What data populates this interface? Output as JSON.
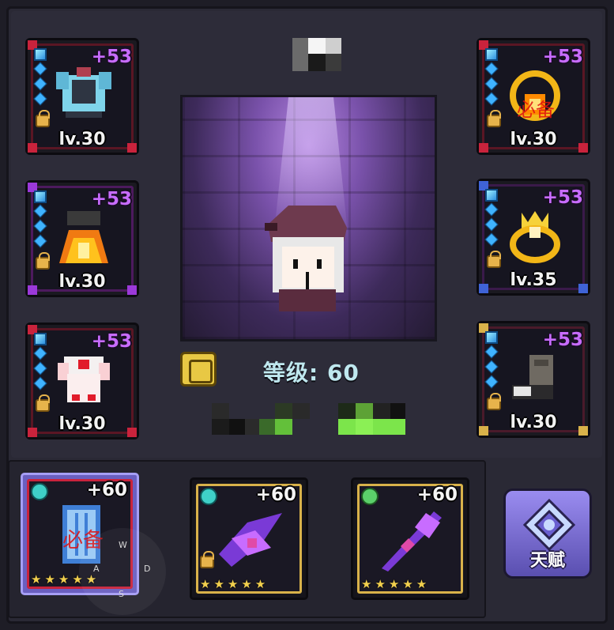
{
  "character": {
    "level_text": "等级: 60"
  },
  "equipment_left": [
    {
      "name": "armor-chest",
      "plus": "+53",
      "level": "lv.30",
      "rarity": "red"
    },
    {
      "name": "flame-robe",
      "plus": "+53",
      "level": "lv.30",
      "rarity": "purple"
    },
    {
      "name": "white-armor",
      "plus": "+53",
      "level": "lv.30",
      "rarity": "red"
    }
  ],
  "equipment_right": [
    {
      "name": "gold-ring",
      "plus": "+53",
      "level": "lv.30",
      "rarity": "red",
      "stamp": "必备"
    },
    {
      "name": "crown-ring",
      "plus": "+53",
      "level": "lv.35",
      "rarity": "blue"
    },
    {
      "name": "boots",
      "plus": "+53",
      "level": "lv.30",
      "rarity": "gold"
    }
  ],
  "weapons": [
    {
      "name": "blue-shield-weapon",
      "plus": "+60",
      "stars": "★★★★★",
      "selected": true,
      "stamp": "必备",
      "gem_color": "#3fd0c8"
    },
    {
      "name": "violet-crossbow",
      "plus": "+60",
      "stars": "★★★★★",
      "selected": false,
      "gem_color": "#3fd0c8"
    },
    {
      "name": "violet-spear",
      "plus": "+60",
      "stars": "★★★★★",
      "selected": false,
      "gem_color": "#5bd06a"
    }
  ],
  "talent_button": {
    "label": "天赋"
  },
  "overlay_keys": {
    "w": "W",
    "a": "A",
    "d": "D",
    "s": "S"
  }
}
